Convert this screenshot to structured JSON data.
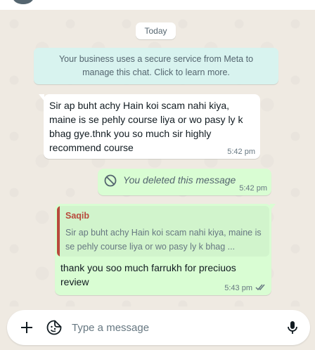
{
  "chat": {
    "date_chip": "Today",
    "system_notice": "Your business uses a secure service from Meta to manage this chat. Click to learn more.",
    "messages": [
      {
        "direction": "incoming",
        "text": "Sir ap buht achy Hain koi scam nahi kiya, maine is se pehly course liya or wo pasy ly k bhag gye.thnk you so much sir highly recommend course",
        "time": "5:42 pm"
      },
      {
        "direction": "outgoing",
        "deleted": true,
        "text": "You deleted this message",
        "time": "5:42 pm",
        "icon": "deleted-icon"
      },
      {
        "direction": "outgoing",
        "quote": {
          "author": "Saqib",
          "text": "Sir ap buht achy Hain koi scam nahi kiya, maine is se pehly course liya or wo pasy ly k bhag ..."
        },
        "text": "thank you soo much farrukh for preciuos review",
        "time": "5:43 pm",
        "status_icon": "double-check-icon"
      }
    ]
  },
  "composer": {
    "placeholder": "Type a message",
    "icons": [
      "plus-icon",
      "sticker-icon",
      "mic-icon"
    ]
  },
  "colors": {
    "background": "#efeae2",
    "incoming_bubble": "#ffffff",
    "outgoing_bubble": "#d9fdd3",
    "system_notice": "#d8f3ef",
    "quote_author": "#b8493c"
  }
}
